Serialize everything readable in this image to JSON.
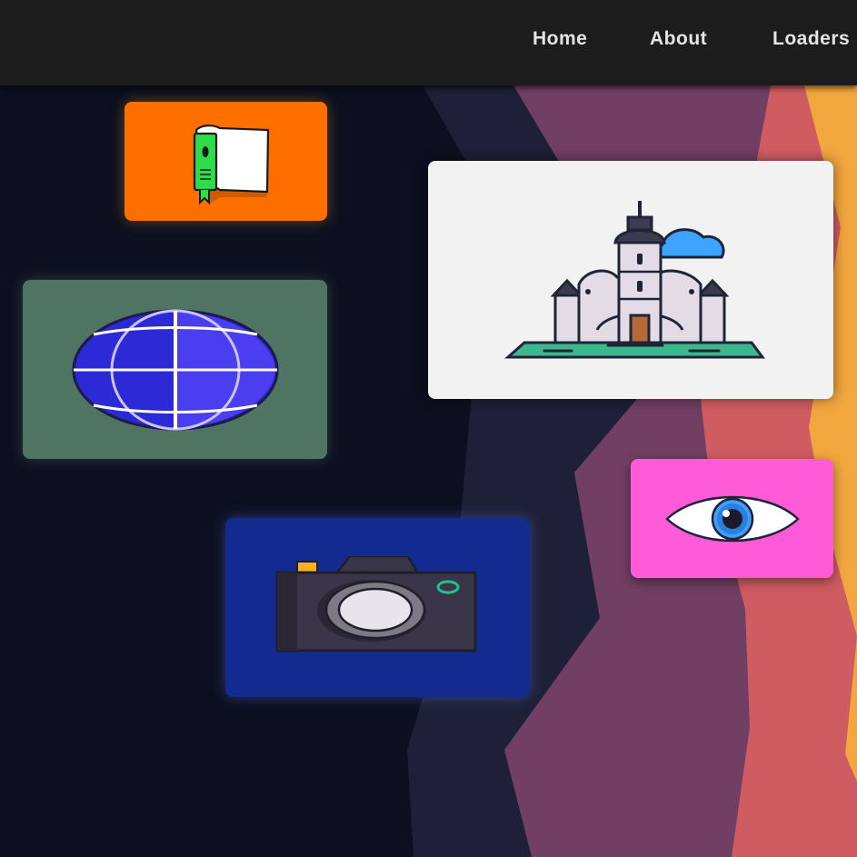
{
  "nav": {
    "items": [
      "Home",
      "About",
      "Loaders"
    ]
  },
  "cards": [
    {
      "name": "book-card",
      "icon": "book-icon",
      "color": "#ff6f00"
    },
    {
      "name": "castle-card",
      "icon": "castle-icon",
      "color": "#f2f2f2"
    },
    {
      "name": "globe-card",
      "icon": "globe-icon",
      "color": "#4f7562"
    },
    {
      "name": "eye-card",
      "icon": "eye-icon",
      "color": "#ff5bd9"
    },
    {
      "name": "camera-card",
      "icon": "camera-icon",
      "color": "#132b91"
    }
  ],
  "colors": {
    "navbar": "#1c1c1c",
    "background": "#0c0f1f",
    "shape_navy": "#1d2036",
    "shape_plum": "#713f63",
    "shape_coral": "#cf5c61",
    "shape_orange": "#f1a63e"
  }
}
